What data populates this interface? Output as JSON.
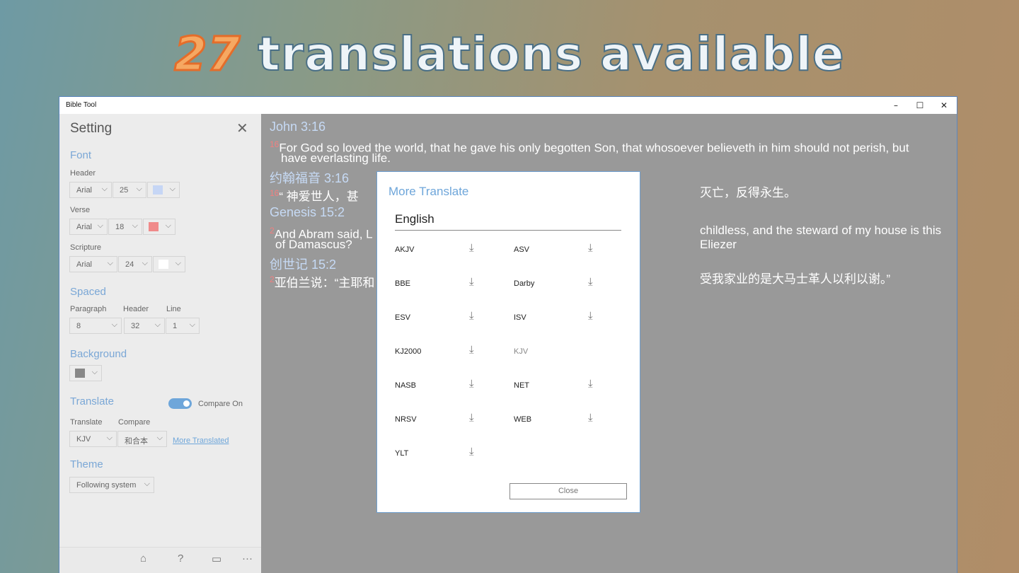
{
  "banner": {
    "number": "27",
    "text": "translations available"
  },
  "window": {
    "title": "Bible Tool",
    "minimize": "–",
    "maximize": "☐",
    "close": "✕"
  },
  "sidebar": {
    "title": "Setting",
    "close": "✕",
    "font": {
      "label": "Font",
      "header": {
        "label": "Header",
        "family": "Arial",
        "size": "25",
        "color": "#c6d6f5"
      },
      "verse": {
        "label": "Verse",
        "family": "Arial",
        "size": "18",
        "color": "#f08a8a"
      },
      "scripture": {
        "label": "Scripture",
        "family": "Arial",
        "size": "24",
        "color": "#ffffff"
      }
    },
    "spaced": {
      "label": "Spaced",
      "paragraph_label": "Paragraph",
      "header_label": "Header",
      "line_label": "Line",
      "paragraph": "8",
      "header": "32",
      "line": "1"
    },
    "background": {
      "label": "Background",
      "color": "#888888"
    },
    "translate": {
      "label": "Translate",
      "compare_toggle": "Compare On",
      "translate_label": "Translate",
      "compare_label": "Compare",
      "translate_value": "KJV",
      "compare_value": "和合本",
      "more_link": "More Translated"
    },
    "theme": {
      "label": "Theme",
      "value": "Following system"
    },
    "chevron": "⌵"
  },
  "content": {
    "passages": [
      {
        "header": "John 3:16",
        "verse_num": "16",
        "text": "For God so loved the world, that he gave his only begotten Son, that whosoever believeth in him should not perish, but",
        "text2": "have everlasting life."
      },
      {
        "header": "约翰福音 3:16",
        "verse_num": "16",
        "text": "“ 神爱世人，甚",
        "text_right": "灭亡，反得永生。"
      },
      {
        "header": "Genesis 15:2",
        "verse_num": "2",
        "text": "And Abram said, L",
        "text_right": "childless, and the steward of my house is this Eliezer",
        "text2": "of Damascus?"
      },
      {
        "header": "创世记 15:2",
        "verse_num": "2",
        "text": "亚伯兰说：“主耶和",
        "text_right": "受我家业的是大马士革人以利以谢。”"
      }
    ]
  },
  "modal": {
    "title": "More Translate",
    "language": "English",
    "download_icon": "⤓",
    "translations": [
      {
        "name": "AKJV",
        "downloaded": false
      },
      {
        "name": "ASV",
        "downloaded": false
      },
      {
        "name": "BBE",
        "downloaded": false
      },
      {
        "name": "Darby",
        "downloaded": false
      },
      {
        "name": "ESV",
        "downloaded": false
      },
      {
        "name": "ISV",
        "downloaded": false
      },
      {
        "name": "KJ2000",
        "downloaded": false
      },
      {
        "name": "KJV",
        "downloaded": true
      },
      {
        "name": "NASB",
        "downloaded": false
      },
      {
        "name": "NET",
        "downloaded": false
      },
      {
        "name": "NRSV",
        "downloaded": false
      },
      {
        "name": "WEB",
        "downloaded": false
      },
      {
        "name": "YLT",
        "downloaded": false
      }
    ],
    "close_button": "Close"
  },
  "bottom_bar": {
    "home": "⌂",
    "help": "?",
    "display": "▭",
    "more": "···"
  }
}
